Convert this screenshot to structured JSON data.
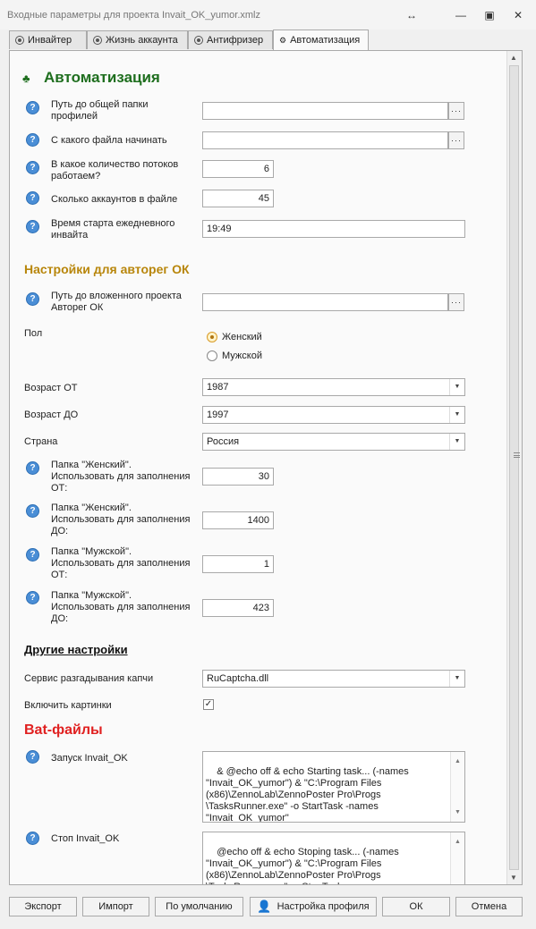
{
  "window": {
    "title": "Входные параметры для проекта Invait_OK_yumor.xmlz"
  },
  "tabs": [
    {
      "label": "Инвайтер"
    },
    {
      "label": "Жизнь аккаунта"
    },
    {
      "label": "Антифризер"
    },
    {
      "label": "Автоматизация"
    }
  ],
  "sections": {
    "automation": "Автоматизация",
    "autoreg": "Настройки для авторег ОК",
    "other": "Другие настройки",
    "bat": "Bat-файлы"
  },
  "fields": {
    "profiles_path": {
      "label": "Путь до общей папки\nпрофилей",
      "value": ""
    },
    "start_file": {
      "label": "С какого файла начинать",
      "value": ""
    },
    "threads": {
      "label": "В какое количество потоков\nработаем?",
      "value": "6"
    },
    "accounts": {
      "label": "Сколько аккаунтов в файле",
      "value": "45"
    },
    "start_time": {
      "label": "Время старта ежедневного\nинвайта",
      "value": "19:49"
    },
    "nested_project": {
      "label": "Путь до вложенного проекта\nАвторег ОК",
      "value": ""
    },
    "gender": {
      "label": "Пол",
      "options": [
        "Женский",
        "Мужской"
      ],
      "selected": "Женский"
    },
    "age_from": {
      "label": "Возраст ОТ",
      "value": "1987"
    },
    "age_to": {
      "label": "Возраст ДО",
      "value": "1997"
    },
    "country": {
      "label": "Страна",
      "value": "Россия"
    },
    "female_from": {
      "label": "Папка \"Женский\".\nИспользовать для заполнения\nОТ:",
      "value": "30"
    },
    "female_to": {
      "label": "Папка \"Женский\".\nИспользовать для заполнения\nДО:",
      "value": "1400"
    },
    "male_from": {
      "label": "Папка \"Мужской\".\nИспользовать для заполнения\nОТ:",
      "value": "1"
    },
    "male_to": {
      "label": "Папка \"Мужской\".\nИспользовать для заполнения\nДО:",
      "value": "423"
    },
    "captcha": {
      "label": "Сервис разгадывания капчи",
      "value": "RuCaptcha.dll"
    },
    "images": {
      "label": "Включить картинки",
      "checked": true
    },
    "start_bat": {
      "label": "Запуск Invait_OK",
      "value": "& @echo off & echo Starting task... (-names\n\"Invait_OK_yumor\") & \"C:\\Program Files\n(x86)\\ZennoLab\\ZennoPoster Pro\\Progs\n\\TasksRunner.exe\" -o StartTask -names\n\"Invait_OK_yumor\""
    },
    "stop_bat": {
      "label": "Стоп Invait_OK",
      "value": "@echo off & echo Stoping task... (-names\n\"Invait_OK_yumor\") & \"C:\\Program Files\n(x86)\\ZennoLab\\ZennoPoster Pro\\Progs\n\\TasksRunner.exe\" -o StopTask -names\n\"Invait_OK_yumor\""
    }
  },
  "buttons": {
    "export": "Экспорт",
    "import": "Импорт",
    "default": "По умолчанию",
    "profile": "Настройка профиля",
    "ok": "ОК",
    "cancel": "Отмена"
  },
  "colors": {
    "automation_title": "#1e6e1e",
    "autoreg_title": "#b8860b",
    "bat_title": "#e02020",
    "help_icon": "#4a8ed6"
  }
}
